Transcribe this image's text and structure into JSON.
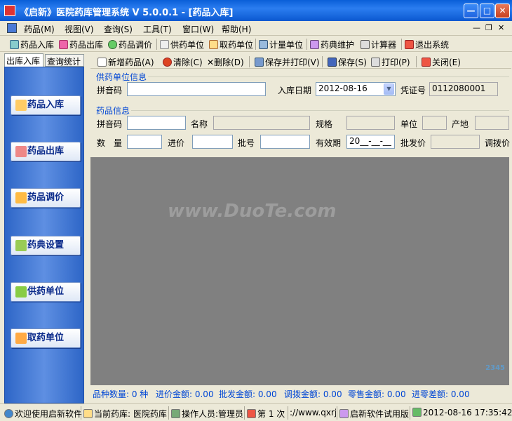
{
  "window": {
    "title": "《启新》医院药库管理系统 V 5.0.0.1 - [药品入库]"
  },
  "menu": [
    "药品(M)",
    "视图(V)",
    "查询(S)",
    "工具(T)",
    "窗口(W)",
    "帮助(H)"
  ],
  "toolbar": [
    "药品入库",
    "药品出库",
    "药品调价",
    "供药单位",
    "取药单位",
    "计量单位",
    "药典维护",
    "计算器",
    "退出系统"
  ],
  "tabs": [
    "出库入库",
    "查询统计"
  ],
  "nav": [
    "药品入库",
    "药品出库",
    "药品调价",
    "药典设置",
    "供药单位",
    "取药单位"
  ],
  "actions": [
    "新增药品(A)",
    "清除(C)",
    "删除(D)",
    "保存并打印(V)",
    "保存(S)",
    "打印(P)",
    "关闭(E)"
  ],
  "supplier": {
    "group": "供药单位信息",
    "pinyin_label": "拼音码",
    "date_label": "入库日期",
    "date": "2012-08-16",
    "voucher_label": "凭证号",
    "voucher": "0112080001"
  },
  "drug": {
    "group": "药品信息",
    "pinyin": "拼音码",
    "name": "名称",
    "spec": "规格",
    "unit": "单位",
    "origin": "产地",
    "qty": "数　量",
    "cost": "进价",
    "batch": "批号",
    "expiry": "有效期",
    "expiry_value": "20__-__-__",
    "wholesale": "批发价",
    "transfer": "调拨价"
  },
  "watermark": "www.DuoTe.com",
  "summary": [
    "品种数量: 0 种",
    "进价金额: 0.00",
    "批发金额: 0.00",
    "调拨金额: 0.00",
    "零售金额: 0.00",
    "进零差额: 0.00"
  ],
  "status": [
    "欢迎使用启新软件",
    "当前药库: 医院药库",
    "操作人员:管理员",
    "第 1 次",
    "://www.qxrj",
    "启新软件试用版",
    "2012-08-16 17:35:42"
  ],
  "colors": {
    "title": "#0a5fd8",
    "nav": "#2e66c7",
    "group": "#0046d5"
  }
}
